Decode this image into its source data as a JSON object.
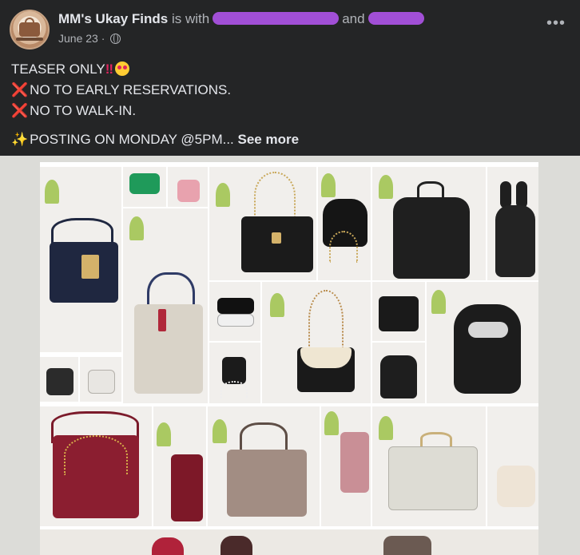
{
  "post": {
    "author": "MM's Ukay Finds",
    "with_text": "is with",
    "and_text": "and",
    "date": "June 23",
    "separator": "·",
    "more_label": "•••"
  },
  "caption": {
    "line1": "TEASER ONLY",
    "line1_bang": "‼",
    "line2": "NO TO EARLY RESERVATIONS.",
    "line3": "NO TO WALK-IN.",
    "line4": "POSTING ON MONDAY @5PM...",
    "see_more": "See more",
    "x_glyph": "❌",
    "sparkle_glyph": "✨"
  },
  "icons": {
    "avatar": "page-avatar-logo",
    "privacy": "globe-icon",
    "more": "more-options-icon"
  },
  "colors": {
    "background": "#242526",
    "text_primary": "#e4e6eb",
    "text_secondary": "#b0b3b8",
    "redaction": "#a14fd6",
    "media_backdrop": "#dcdcd8"
  },
  "media": {
    "type": "photo-collage",
    "subject": "handbags"
  }
}
